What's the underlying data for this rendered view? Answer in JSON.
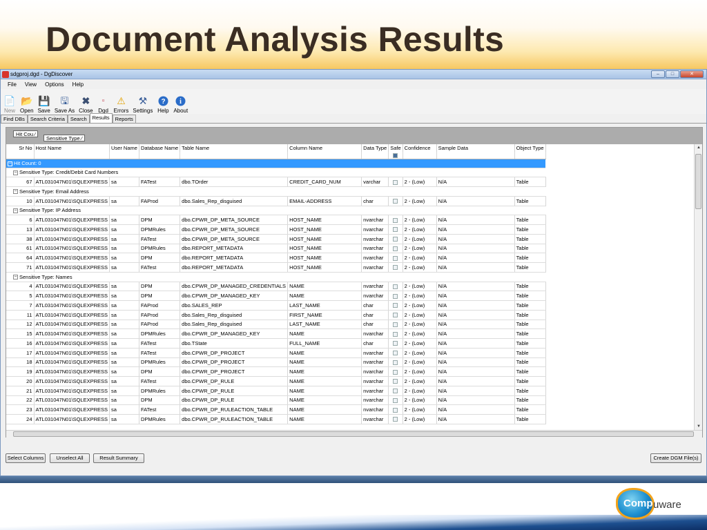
{
  "slide": {
    "title": "Document Analysis Results"
  },
  "window": {
    "title": "sdgproj.dgd - DgDiscover"
  },
  "menu": [
    "File",
    "View",
    "Options",
    "Help"
  ],
  "toolbar": [
    {
      "label": "New",
      "icon": "new-icon",
      "disabled": true
    },
    {
      "label": "Open",
      "icon": "open-icon"
    },
    {
      "label": "Save",
      "icon": "save-icon"
    },
    {
      "label": "Save As",
      "icon": "save-as-icon"
    },
    {
      "label": "Close",
      "icon": "close-icon"
    },
    {
      "label": "Dgd",
      "icon": "dgd-icon"
    },
    {
      "label": "Errors",
      "icon": "warning-icon"
    },
    {
      "label": "Settings",
      "icon": "settings-icon"
    },
    {
      "label": "Help",
      "icon": "help-icon"
    },
    {
      "label": "About",
      "icon": "info-icon"
    }
  ],
  "tabs": [
    "Find DBs",
    "Search Criteria",
    "Search",
    "Results",
    "Reports"
  ],
  "group_chips": [
    "Hit Cou",
    "Sensitive Type"
  ],
  "columns": [
    "Sr No",
    "Host Name",
    "User Name",
    "Database Name",
    "Table Name",
    "Column Name",
    "Data Type",
    "Safe",
    "Confidence",
    "Sample Data",
    "Object Type"
  ],
  "hit_group_label": "Hit Count: 0",
  "groups": [
    {
      "label": "Sensitive Type: Credit/Debit Card Numbers",
      "rows": [
        {
          "sr": "67",
          "host": "ATL031047N01\\SQLEXPRESS",
          "user": "sa",
          "db": "FATest",
          "table": "dbo.TOrder",
          "column": "CREDIT_CARD_NUM",
          "type": "varchar",
          "confidence": "2 - (Low)",
          "sample": "N/A",
          "object": "Table"
        }
      ]
    },
    {
      "label": "Sensitive Type: Email Address",
      "rows": [
        {
          "sr": "10",
          "host": "ATL031047N01\\SQLEXPRESS",
          "user": "sa",
          "db": "FAProd",
          "table": "dbo.Sales_Rep_disguised",
          "column": "EMAIL-ADDRESS",
          "type": "char",
          "confidence": "2 - (Low)",
          "sample": "N/A",
          "object": "Table"
        }
      ]
    },
    {
      "label": "Sensitive Type: IP Address",
      "rows": [
        {
          "sr": "6",
          "host": "ATL031047N01\\SQLEXPRESS",
          "user": "sa",
          "db": "DPM",
          "table": "dbo.CPWR_DP_META_SOURCE",
          "column": "HOST_NAME",
          "type": "nvarchar",
          "confidence": "2 - (Low)",
          "sample": "N/A",
          "object": "Table"
        },
        {
          "sr": "13",
          "host": "ATL031047N01\\SQLEXPRESS",
          "user": "sa",
          "db": "DPMRules",
          "table": "dbo.CPWR_DP_META_SOURCE",
          "column": "HOST_NAME",
          "type": "nvarchar",
          "confidence": "2 - (Low)",
          "sample": "N/A",
          "object": "Table"
        },
        {
          "sr": "38",
          "host": "ATL031047N01\\SQLEXPRESS",
          "user": "sa",
          "db": "FATest",
          "table": "dbo.CPWR_DP_META_SOURCE",
          "column": "HOST_NAME",
          "type": "nvarchar",
          "confidence": "2 - (Low)",
          "sample": "N/A",
          "object": "Table"
        },
        {
          "sr": "61",
          "host": "ATL031047N01\\SQLEXPRESS",
          "user": "sa",
          "db": "DPMRules",
          "table": "dbo.REPORT_METADATA",
          "column": "HOST_NAME",
          "type": "nvarchar",
          "confidence": "2 - (Low)",
          "sample": "N/A",
          "object": "Table"
        },
        {
          "sr": "64",
          "host": "ATL031047N01\\SQLEXPRESS",
          "user": "sa",
          "db": "DPM",
          "table": "dbo.REPORT_METADATA",
          "column": "HOST_NAME",
          "type": "nvarchar",
          "confidence": "2 - (Low)",
          "sample": "N/A",
          "object": "Table"
        },
        {
          "sr": "71",
          "host": "ATL031047N01\\SQLEXPRESS",
          "user": "sa",
          "db": "FATest",
          "table": "dbo.REPORT_METADATA",
          "column": "HOST_NAME",
          "type": "nvarchar",
          "confidence": "2 - (Low)",
          "sample": "N/A",
          "object": "Table"
        }
      ]
    },
    {
      "label": "Sensitive Type: Names",
      "rows": [
        {
          "sr": "4",
          "host": "ATL031047N01\\SQLEXPRESS",
          "user": "sa",
          "db": "DPM",
          "table": "dbo.CPWR_DP_MANAGED_CREDENTIALS",
          "column": "NAME",
          "type": "nvarchar",
          "confidence": "2 - (Low)",
          "sample": "N/A",
          "object": "Table"
        },
        {
          "sr": "5",
          "host": "ATL031047N01\\SQLEXPRESS",
          "user": "sa",
          "db": "DPM",
          "table": "dbo.CPWR_DP_MANAGED_KEY",
          "column": "NAME",
          "type": "nvarchar",
          "confidence": "2 - (Low)",
          "sample": "N/A",
          "object": "Table"
        },
        {
          "sr": "7",
          "host": "ATL031047N01\\SQLEXPRESS",
          "user": "sa",
          "db": "FAProd",
          "table": "dbo.SALES_REP",
          "column": "LAST_NAME",
          "type": "char",
          "confidence": "2 - (Low)",
          "sample": "N/A",
          "object": "Table"
        },
        {
          "sr": "11",
          "host": "ATL031047N01\\SQLEXPRESS",
          "user": "sa",
          "db": "FAProd",
          "table": "dbo.Sales_Rep_disguised",
          "column": "FIRST_NAME",
          "type": "char",
          "confidence": "2 - (Low)",
          "sample": "N/A",
          "object": "Table"
        },
        {
          "sr": "12",
          "host": "ATL031047N01\\SQLEXPRESS",
          "user": "sa",
          "db": "FAProd",
          "table": "dbo.Sales_Rep_disguised",
          "column": "LAST_NAME",
          "type": "char",
          "confidence": "2 - (Low)",
          "sample": "N/A",
          "object": "Table"
        },
        {
          "sr": "15",
          "host": "ATL031047N01\\SQLEXPRESS",
          "user": "sa",
          "db": "DPMRules",
          "table": "dbo.CPWR_DP_MANAGED_KEY",
          "column": "NAME",
          "type": "nvarchar",
          "confidence": "2 - (Low)",
          "sample": "N/A",
          "object": "Table"
        },
        {
          "sr": "16",
          "host": "ATL031047N01\\SQLEXPRESS",
          "user": "sa",
          "db": "FATest",
          "table": "dbo.TState",
          "column": "FULL_NAME",
          "type": "char",
          "confidence": "2 - (Low)",
          "sample": "N/A",
          "object": "Table"
        },
        {
          "sr": "17",
          "host": "ATL031047N01\\SQLEXPRESS",
          "user": "sa",
          "db": "FATest",
          "table": "dbo.CPWR_DP_PROJECT",
          "column": "NAME",
          "type": "nvarchar",
          "confidence": "2 - (Low)",
          "sample": "N/A",
          "object": "Table"
        },
        {
          "sr": "18",
          "host": "ATL031047N01\\SQLEXPRESS",
          "user": "sa",
          "db": "DPMRules",
          "table": "dbo.CPWR_DP_PROJECT",
          "column": "NAME",
          "type": "nvarchar",
          "confidence": "2 - (Low)",
          "sample": "N/A",
          "object": "Table"
        },
        {
          "sr": "19",
          "host": "ATL031047N01\\SQLEXPRESS",
          "user": "sa",
          "db": "DPM",
          "table": "dbo.CPWR_DP_PROJECT",
          "column": "NAME",
          "type": "nvarchar",
          "confidence": "2 - (Low)",
          "sample": "N/A",
          "object": "Table"
        },
        {
          "sr": "20",
          "host": "ATL031047N01\\SQLEXPRESS",
          "user": "sa",
          "db": "FATest",
          "table": "dbo.CPWR_DP_RULE",
          "column": "NAME",
          "type": "nvarchar",
          "confidence": "2 - (Low)",
          "sample": "N/A",
          "object": "Table"
        },
        {
          "sr": "21",
          "host": "ATL031047N01\\SQLEXPRESS",
          "user": "sa",
          "db": "DPMRules",
          "table": "dbo.CPWR_DP_RULE",
          "column": "NAME",
          "type": "nvarchar",
          "confidence": "2 - (Low)",
          "sample": "N/A",
          "object": "Table"
        },
        {
          "sr": "22",
          "host": "ATL031047N01\\SQLEXPRESS",
          "user": "sa",
          "db": "DPM",
          "table": "dbo.CPWR_DP_RULE",
          "column": "NAME",
          "type": "nvarchar",
          "confidence": "2 - (Low)",
          "sample": "N/A",
          "object": "Table"
        },
        {
          "sr": "23",
          "host": "ATL031047N01\\SQLEXPRESS",
          "user": "sa",
          "db": "FATest",
          "table": "dbo.CPWR_DP_RULEACTION_TABLE",
          "column": "NAME",
          "type": "nvarchar",
          "confidence": "2 - (Low)",
          "sample": "N/A",
          "object": "Table"
        },
        {
          "sr": "24",
          "host": "ATL031047N01\\SQLEXPRESS",
          "user": "sa",
          "db": "DPMRules",
          "table": "dbo.CPWR_DP_RULEACTION_TABLE",
          "column": "NAME",
          "type": "nvarchar",
          "confidence": "2 - (Low)",
          "sample": "N/A",
          "object": "Table"
        }
      ]
    }
  ],
  "buttons": {
    "select_columns": "Select Columns",
    "unselect_all": "Unselect All",
    "result_summary": "Result Summary",
    "create_dgm": "Create DGM File(s)"
  },
  "logo": {
    "brand_a": "Comp",
    "brand_b": "uware",
    "colors": {
      "blue": "#1e8fcf",
      "orange": "#f3a31b"
    }
  },
  "colors": {
    "selection": "#3399ff",
    "title": "#3a2d23"
  }
}
